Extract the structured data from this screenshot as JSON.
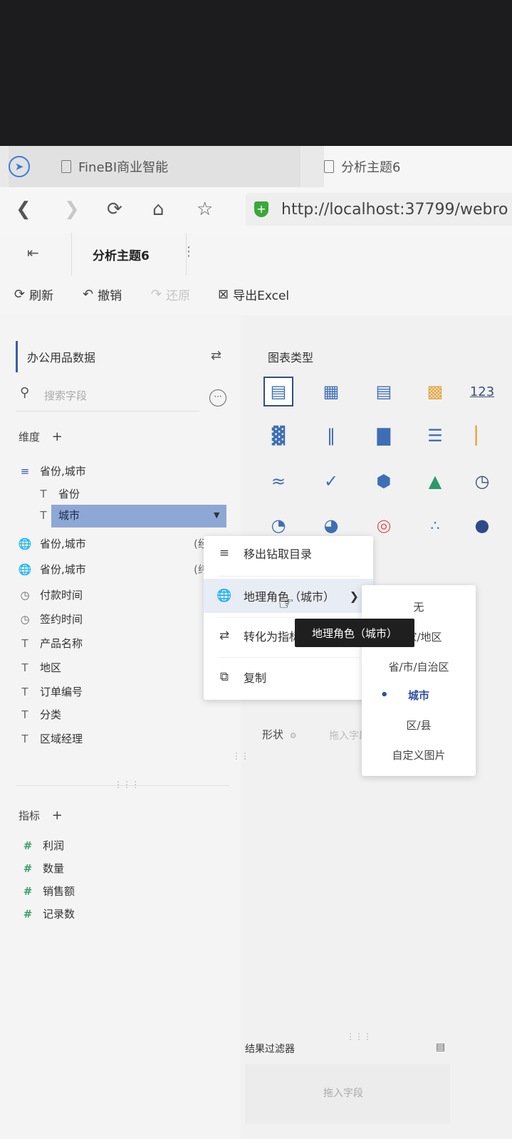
{
  "browser": {
    "tabs": [
      {
        "title": "FineBI商业智能"
      },
      {
        "title": "分析主题6"
      }
    ],
    "url": "http://localhost:37799/webro"
  },
  "app": {
    "title": "分析主题6",
    "toolbar": {
      "refresh": "刷新",
      "undo": "撤销",
      "redo": "还原",
      "export": "导出Excel"
    }
  },
  "left": {
    "dataset": "办公用品数据",
    "search_placeholder": "搜索字段",
    "dimension_header": "维度",
    "drill_group": "省份,城市",
    "drill_children": [
      "省份",
      "城市"
    ],
    "fields": [
      {
        "label": "省份,城市",
        "icon": "globe-icon",
        "suffix": "(经"
      },
      {
        "label": "省份,城市",
        "icon": "globe-icon",
        "suffix": "(纬"
      },
      {
        "label": "付款时间",
        "icon": "clock-icon"
      },
      {
        "label": "签约时间",
        "icon": "clock-icon"
      },
      {
        "label": "产品名称",
        "icon": "text-icon"
      },
      {
        "label": "地区",
        "icon": "text-icon"
      },
      {
        "label": "订单编号",
        "icon": "text-icon"
      },
      {
        "label": "分类",
        "icon": "text-icon"
      },
      {
        "label": "区域经理",
        "icon": "text-icon"
      }
    ],
    "measure_header": "指标",
    "measures": [
      "利润",
      "数量",
      "销售额",
      "记录数"
    ]
  },
  "right": {
    "chart_type_label": "图表类型",
    "shape_label": "形状",
    "drop_hint": "拖入字段",
    "filter_title": "结果过滤器",
    "filter_hint": "拖入字段"
  },
  "context_menu": {
    "items": [
      {
        "label": "移出钻取目录"
      },
      {
        "label": "地理角色（城市）"
      },
      {
        "label": "转化为指标"
      },
      {
        "label": "复制"
      }
    ]
  },
  "submenu": {
    "items": [
      "无",
      "国家/地区",
      "省/市/自治区",
      "城市",
      "区/县",
      "自定义图片"
    ],
    "selected": "城市"
  },
  "tooltip": "地理角色（城市）"
}
